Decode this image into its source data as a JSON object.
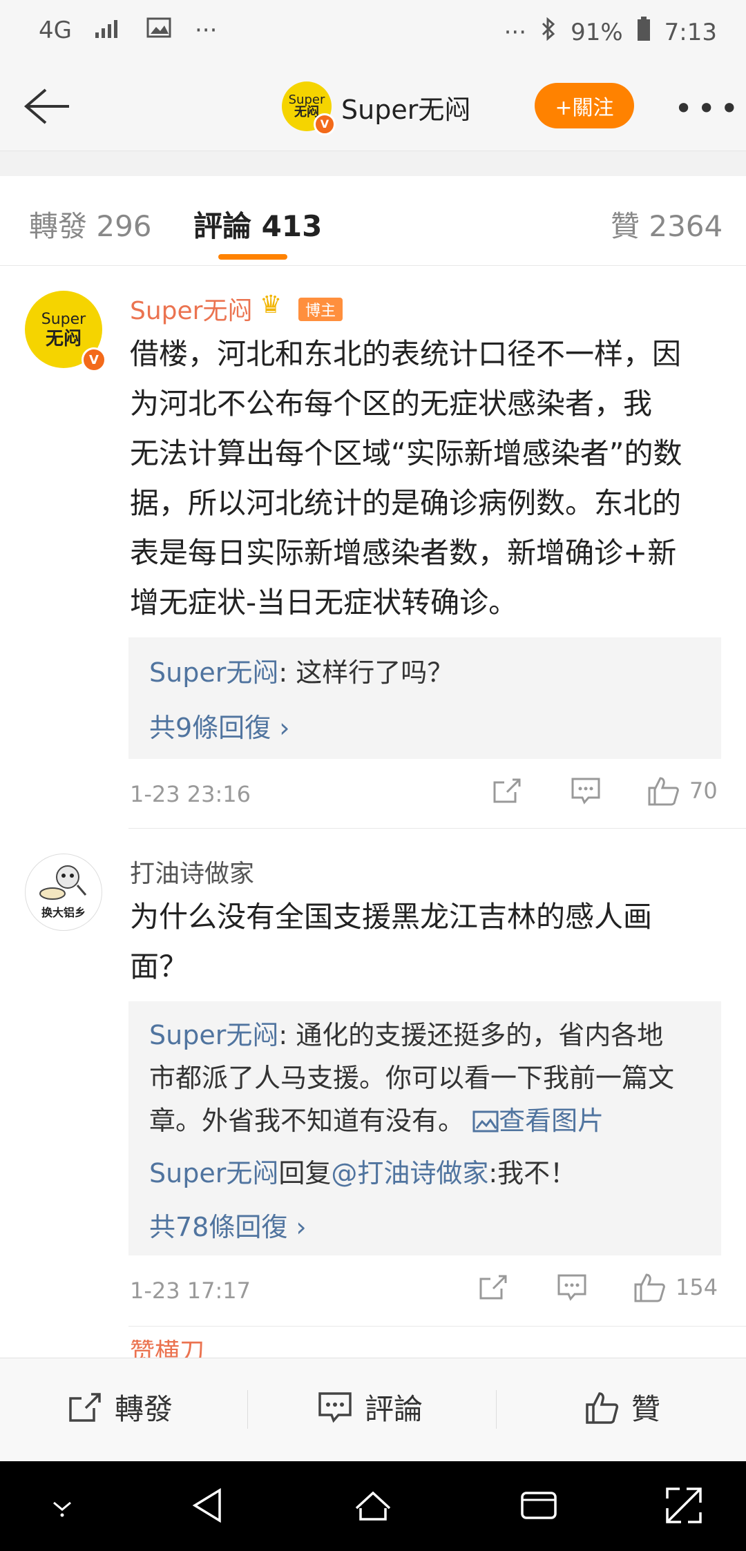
{
  "status_bar": {
    "network": "4G",
    "battery": "91%",
    "time": "7:13",
    "dots_left": "···",
    "dots_right": "···"
  },
  "nav": {
    "title": "Super无闷",
    "follow_label": "+關注",
    "avatar_text_top": "Super",
    "avatar_text_bottom": "无闷",
    "verified": "V"
  },
  "tabs": [
    {
      "label": "轉發 296"
    },
    {
      "label": "評論 413"
    },
    {
      "label": "贊 2364"
    }
  ],
  "comments": [
    {
      "author": "Super无闷",
      "host_badge": "博主",
      "avatar_text_top": "Super",
      "avatar_text_bottom": "无闷",
      "text_lines": [
        "借楼，河北和东北的表统计口径不一样，因",
        "为河北不公布每个区的无症状感染者，我",
        "无法计算出每个区域“实际新增感染者”的数",
        "据，所以河北统计的是确诊病例数。东北的",
        "表是每日实际新增感染者数，新增确诊+新",
        "增无症状-当日无症状转确诊。"
      ],
      "reply_user": "Super无闷",
      "reply_text": ": 这样行了吗？",
      "more_replies": "共9條回復 ›",
      "time": "1-23 23:16",
      "likes": "70"
    },
    {
      "author": "打油诗做家",
      "avatar_text": "换大铝乡",
      "text_lines": [
        "为什么没有全国支援黑龙江吉林的感人画",
        "面？"
      ],
      "reply1_user": "Super无闷",
      "reply1_lines": [
        ": 通化的支援还挺多的，省内各地",
        "市都派了人马支援。你可以看一下我前一篇文",
        "章。外省我不知道有没有。"
      ],
      "reply1_link": "查看图片",
      "reply2_user": "Super无闷",
      "reply2_mid": "回复",
      "reply2_mention": "@打油诗做家",
      "reply2_text": ":我不！",
      "more_replies": "共78條回復 ›",
      "time": "1-23 17:17",
      "likes": "154"
    },
    {
      "author": "赞横刀"
    }
  ],
  "bottom_bar": {
    "repost": "轉發",
    "comment": "評論",
    "like": "贊"
  },
  "colors": {
    "accent": "#ff8200",
    "link_blue": "#50749f",
    "author_orange": "#eb7350",
    "avatar_yellow": "#f5d400"
  }
}
